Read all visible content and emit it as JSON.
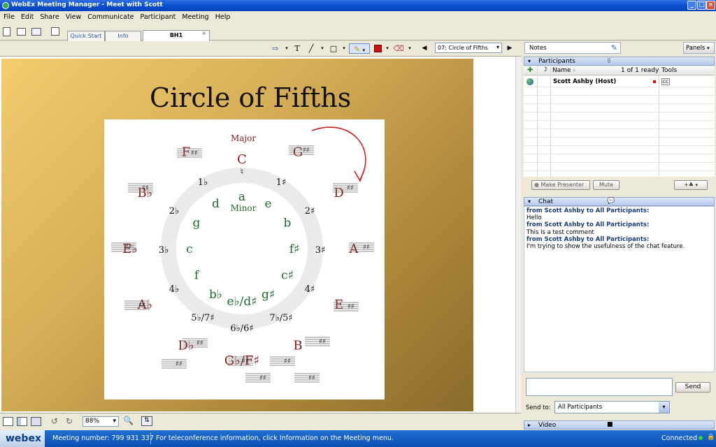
{
  "window": {
    "title": "WebEx Meeting Manager - Meet with Scott"
  },
  "menu": [
    "File",
    "Edit",
    "Share",
    "View",
    "Communicate",
    "Participant",
    "Meeting",
    "Help"
  ],
  "tabs": [
    {
      "label": "Quick Start"
    },
    {
      "label": "Info"
    },
    {
      "label": "BH1"
    }
  ],
  "annot": {
    "text_tool": "T",
    "page": "07: Circle of Fifths"
  },
  "slide": {
    "title": "Circle of Fifths",
    "major_label": "Major",
    "minor_label": "Minor",
    "major_keys": [
      "C",
      "G",
      "D",
      "A",
      "E",
      "B",
      "G♭/F♯",
      "D♭",
      "A♭",
      "E♭",
      "B♭",
      "F"
    ],
    "minor_keys": [
      "a",
      "e",
      "b",
      "f♯",
      "c♯",
      "g♯",
      "e♭/d♯",
      "b♭",
      "f",
      "c",
      "g",
      "d"
    ],
    "signatures": [
      "♮",
      "1♯",
      "2♯",
      "3♯",
      "4♯",
      "7♭/5♯",
      "6♭/6♯",
      "5♭/7♯",
      "4♭",
      "3♭",
      "2♭",
      "1♭"
    ]
  },
  "zoom": {
    "value": "88%"
  },
  "notes": {
    "label": "Notes",
    "panels_label": "Panels"
  },
  "participants": {
    "header": "Participants",
    "col_name": "Name",
    "ready": "1 of 1 ready",
    "col_tools": "Tools",
    "rows": [
      {
        "name": "Scott Ashby (Host)"
      }
    ],
    "make_presenter": "Make Presenter",
    "mute": "Mute"
  },
  "chat": {
    "header": "Chat",
    "messages": [
      {
        "from": "from Scott Ashby to All Participants:",
        "text": "Hello"
      },
      {
        "from": "from Scott Ashby to All Participants:",
        "text": "This is a test comment"
      },
      {
        "from": "from Scott Ashby to All Participants:",
        "text": "I'm trying to show the usefulness of the chat feature."
      }
    ],
    "send": "Send",
    "send_to_label": "Send to:",
    "send_to_value": "All Participants"
  },
  "video": {
    "header": "Video"
  },
  "status": {
    "logo": "webex",
    "meeting_number": "Meeting number: 799 931 337",
    "info": "For teleconference information, click Information on the Meeting menu.",
    "connection": "Connected"
  },
  "colors": {
    "titlebar": "#0a4fd0",
    "major": "#8b1a1a",
    "minor": "#1e6b2a",
    "arrow": "#cc2222",
    "panel_header": "#b5c9ec"
  }
}
